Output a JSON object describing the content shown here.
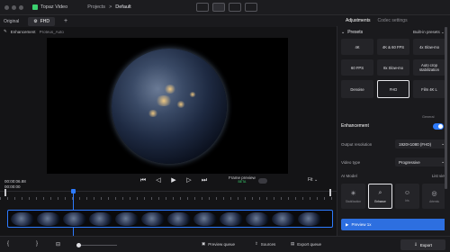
{
  "titlebar": {
    "app_name": "Topaz Video",
    "projects": "Projects",
    "separator": ">",
    "current": "Default"
  },
  "right_tabs": {
    "adjustments": "Adjustments",
    "codec": "Codec settings"
  },
  "tabs": {
    "original": "Original",
    "fhd": "FHD",
    "plus": "+"
  },
  "subbar": {
    "label": "Enhancement",
    "model": "Proteus_Auto"
  },
  "frame_preview": {
    "label": "Frame preview",
    "badge": "BETA"
  },
  "zoom": {
    "label": "Fit",
    "chevron": "⌄"
  },
  "timecode": {
    "current": "00:00:06.88",
    "duration": "00:00:00"
  },
  "controls": [
    "⏮",
    "◁",
    "▶",
    "▷",
    "⏭"
  ],
  "presets": {
    "title": "Presets",
    "builtin": "Built-in presets ⌄",
    "items": [
      "4K",
      "4K & 60 FPS",
      "4x Slow-mo",
      "60 FPS",
      "8x Slow-mo",
      "Auto crop stabilization",
      "Denoise",
      "FHD",
      "Film 4K L"
    ],
    "selected_index": 7,
    "general_label": "General"
  },
  "enhancement": {
    "title": "Enhancement",
    "output_resolution_label": "Output resolution",
    "output_resolution_value": "1920×1080 (FHD)",
    "video_type_label": "Video type",
    "video_type_value": "Progressive",
    "ai_model_label": "AI Model",
    "list_view": "List view",
    "models": [
      "Stabilization",
      "Enhance",
      "Iris",
      "Artemis"
    ],
    "selected_model_index": 1
  },
  "preview_button": {
    "label": "Preview 1x"
  },
  "bottombar": {
    "preview_queue": "Preview queue",
    "sources": "Sources",
    "export_queue": "Export queue",
    "export": "Export"
  },
  "colors": {
    "accent": "#2d7bff",
    "brand": "#3bd16f",
    "selected_border": "#e6e6ea"
  },
  "icons": [
    "apple-traffic-lights",
    "grid-icon",
    "split-icon",
    "compare-icon",
    "play-icon",
    "scissors-icon",
    "crop-icon",
    "export-icon"
  ]
}
